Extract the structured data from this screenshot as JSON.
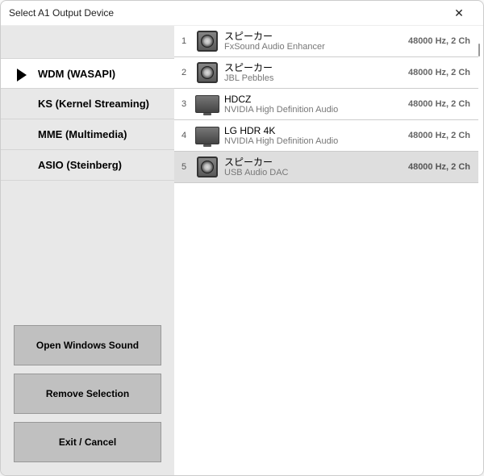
{
  "window": {
    "title": "Select A1 Output Device"
  },
  "sidebar": {
    "apis": [
      {
        "label": "WDM (WASAPI)",
        "selected": true
      },
      {
        "label": "KS (Kernel Streaming)",
        "selected": false
      },
      {
        "label": "MME (Multimedia)",
        "selected": false
      },
      {
        "label": "ASIO (Steinberg)",
        "selected": false
      }
    ],
    "buttons": {
      "open_sound": "Open Windows Sound",
      "remove": "Remove Selection",
      "exit": "Exit / Cancel"
    }
  },
  "devices": [
    {
      "index": "1",
      "name": "スピーカー",
      "desc": "FxSound Audio Enhancer",
      "info": "48000 Hz, 2 Ch",
      "icon": "speaker",
      "selected": false
    },
    {
      "index": "2",
      "name": "スピーカー",
      "desc": "JBL Pebbles",
      "info": "48000 Hz, 2 Ch",
      "icon": "speaker",
      "selected": false
    },
    {
      "index": "3",
      "name": "HDCZ",
      "desc": "NVIDIA High Definition Audio",
      "info": "48000 Hz, 2 Ch",
      "icon": "monitor",
      "selected": false
    },
    {
      "index": "4",
      "name": "LG HDR 4K",
      "desc": "NVIDIA High Definition Audio",
      "info": "48000 Hz, 2 Ch",
      "icon": "monitor",
      "selected": false
    },
    {
      "index": "5",
      "name": "スピーカー",
      "desc": "USB Audio DAC",
      "info": "48000 Hz, 2 Ch",
      "icon": "speaker",
      "selected": true
    }
  ]
}
